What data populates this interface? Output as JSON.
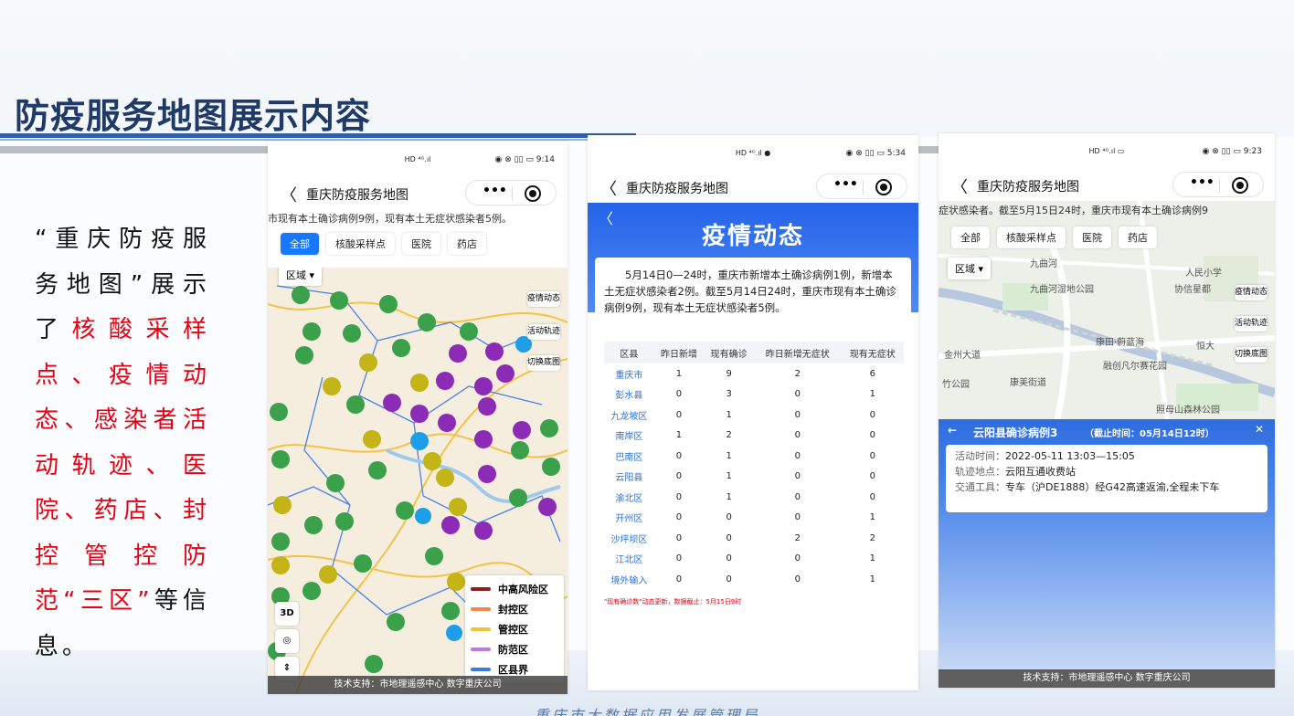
{
  "title": "防疫服务地图展示内容",
  "desc": {
    "p1": "“重庆防疫服务地图”展示了",
    "p2": "核酸采样点、疫情动态、感染者活动轨迹、医院、药店、封控管控防范“三区”",
    "p3": "等信息。"
  },
  "footer": "重庆市大数据应用发展管理局",
  "phone1": {
    "time": "9:14",
    "nav_title": "重庆防疫服务地图",
    "ticker": "市现有本土确诊病例9例，现有本土无症状感染者5例。",
    "tabs": [
      "全部",
      "核酸采样点",
      "医院",
      "药店"
    ],
    "region": "区域 ▾",
    "side": [
      "疫情动态",
      "活动轨迹",
      "切换底图"
    ],
    "legend": [
      {
        "label": "中高风险区",
        "color": "#8b1e1e"
      },
      {
        "label": "封控区",
        "color": "#f0864a"
      },
      {
        "label": "管控区",
        "color": "#f0c13a"
      },
      {
        "label": "防范区",
        "color": "#c177e0"
      },
      {
        "label": "区县界",
        "color": "#3a7be0"
      }
    ],
    "tool_3d": "3D",
    "tech": "技术支持：市地理遥感中心  数字重庆公司"
  },
  "phone2": {
    "time": "5:34",
    "nav_title": "重庆防疫服务地图",
    "banner": "疫情动态",
    "summary": "5月14日0—24时，重庆市新增本土确诊病例1例，新增本土无症状感染者2例。截至5月14日24时，重庆市现有本土确诊病例9例，现有本土无症状感染者5例。",
    "columns": [
      "区县",
      "昨日新增",
      "现有确诊",
      "昨日新增无症状",
      "现有无症状"
    ],
    "rows": [
      [
        "重庆市",
        "1",
        "9",
        "2",
        "6"
      ],
      [
        "彭水县",
        "0",
        "3",
        "0",
        "1"
      ],
      [
        "九龙坡区",
        "0",
        "1",
        "0",
        "0"
      ],
      [
        "南岸区",
        "1",
        "2",
        "0",
        "0"
      ],
      [
        "巴南区",
        "0",
        "1",
        "0",
        "0"
      ],
      [
        "云阳县",
        "0",
        "1",
        "0",
        "0"
      ],
      [
        "渝北区",
        "0",
        "1",
        "0",
        "0"
      ],
      [
        "开州区",
        "0",
        "0",
        "0",
        "1"
      ],
      [
        "沙坪坝区",
        "0",
        "0",
        "2",
        "2"
      ],
      [
        "江北区",
        "0",
        "0",
        "0",
        "1"
      ],
      [
        "境外输入",
        "0",
        "0",
        "0",
        "1"
      ]
    ],
    "note": "\"现有确诊数\"动态更新，数据截止：5月15日9时"
  },
  "phone3": {
    "time": "9:23",
    "nav_title": "重庆防疫服务地图",
    "ticker": "症状感染者。截至5月15日24时，重庆市现有本土确诊病例9",
    "tabs": [
      "全部",
      "核酸采样点",
      "医院",
      "药店"
    ],
    "region": "区域 ▾",
    "side": [
      "疫情动态",
      "活动轨迹",
      "切换底图"
    ],
    "places": [
      "九曲河",
      "人民小学",
      "九曲河湿地公园",
      "协信星都",
      "康田·蔚蓝海",
      "恒大",
      "融创凡尔赛花园",
      "金州大道",
      "康美街道",
      "竹公园",
      "照母山森林公园"
    ],
    "track_title": "云阳县确诊病例3",
    "track_cutoff": "（截止时间：05月14日12时）",
    "fields": [
      {
        "label": "活动时间：",
        "value": "2022-05-11 13:03—15:05"
      },
      {
        "label": "轨迹地点：",
        "value": "云阳互通收费站"
      },
      {
        "label": "交通工具：",
        "value": "专车（沪DE1888）经G42高速返渝,全程未下车"
      }
    ],
    "tech": "技术支持：市地理遥感中心  数字重庆公司"
  }
}
